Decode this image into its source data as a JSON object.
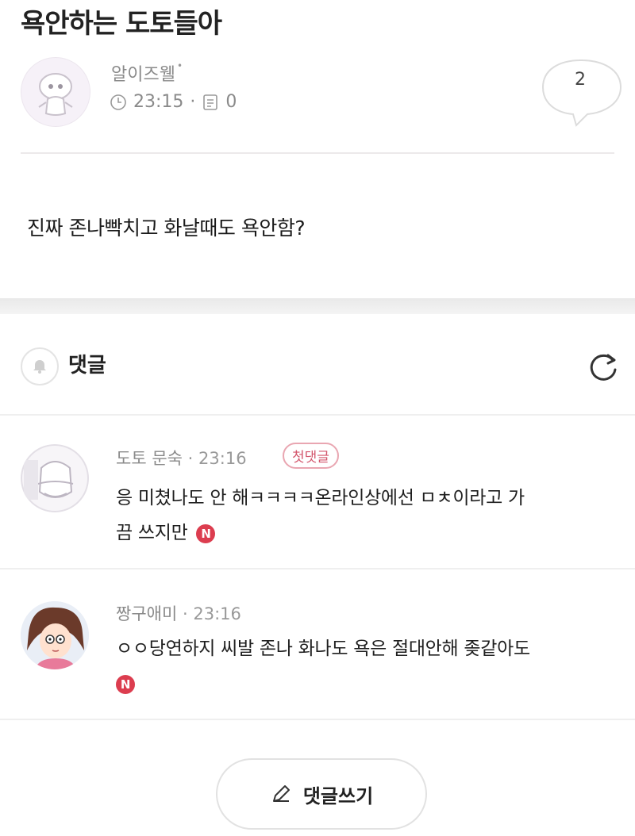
{
  "post": {
    "title": "욕안하는 도토들아",
    "author": "알이즈웰",
    "author_mark": "•",
    "time": "23:15",
    "separator": "·",
    "view_count": "0",
    "comment_count": "2",
    "body": "진짜 존나빡치고 화날때도 욕안함?"
  },
  "comments_section": {
    "label": "댓글",
    "icons": {
      "bell": "bell-icon",
      "refresh": "refresh-icon"
    }
  },
  "comments": [
    {
      "author": "도토 문숙",
      "separator": "·",
      "time": "23:16",
      "badge": "첫댓글",
      "line1": "응 미쳤나도 안 해ㅋㅋㅋㅋ온라인상에선 ㅁㅊ이라고 가",
      "line2": "끔 쓰지만",
      "new_badge": "N"
    },
    {
      "author": "짱구애미",
      "separator": "·",
      "time": "23:16",
      "line1": "ㅇㅇ당연하지 씨발 존나 화나도 욕은 절대안해 좆같아도",
      "new_badge": "N"
    }
  ],
  "write_button": {
    "label": "댓글쓰기",
    "icon": "pencil-icon"
  },
  "colors": {
    "badge_red": "#dc3d4f",
    "first_badge": "#d3566c"
  }
}
